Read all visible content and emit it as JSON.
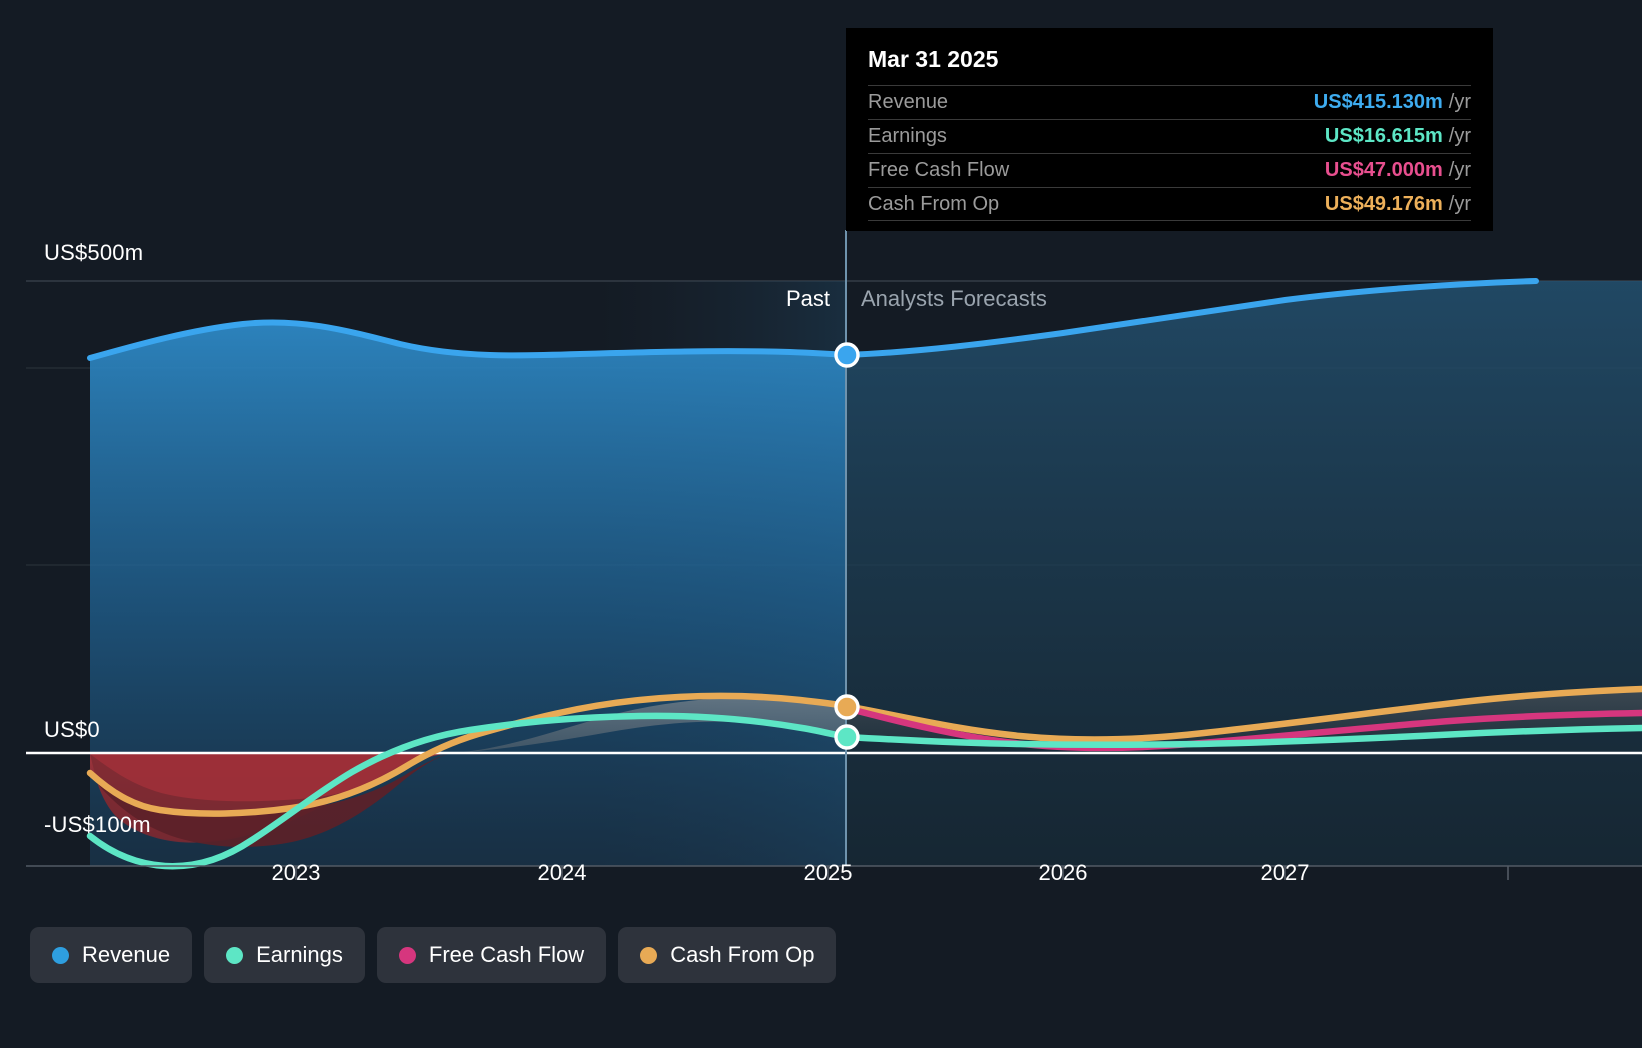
{
  "axes": {
    "y_labels": [
      {
        "text": "US$500m",
        "value": 500
      },
      {
        "text": "US$0",
        "value": 0
      },
      {
        "text": "-US$100m",
        "value": -100
      }
    ],
    "x_labels": [
      "2023",
      "2024",
      "2025",
      "2026",
      "2027"
    ]
  },
  "regions": {
    "past_label": "Past",
    "forecast_label": "Analysts Forecasts"
  },
  "tooltip": {
    "date": "Mar 31 2025",
    "rows": [
      {
        "label": "Revenue",
        "value": "US$415.130m",
        "unit": "/yr",
        "color": "#3eacf0"
      },
      {
        "label": "Earnings",
        "value": "US$16.615m",
        "unit": "/yr",
        "color": "#5de6c5"
      },
      {
        "label": "Free Cash Flow",
        "value": "US$47.000m",
        "unit": "/yr",
        "color": "#e84f8f"
      },
      {
        "label": "Cash From Op",
        "value": "US$49.176m",
        "unit": "/yr",
        "color": "#edb05a"
      }
    ]
  },
  "legend": [
    {
      "label": "Revenue",
      "color": "#2e9fe0"
    },
    {
      "label": "Earnings",
      "color": "#5de6c5"
    },
    {
      "label": "Free Cash Flow",
      "color": "#d6367e"
    },
    {
      "label": "Cash From Op",
      "color": "#e8aa55"
    }
  ],
  "colors": {
    "background": "#141b24",
    "revenue": "#2e9fe0",
    "earnings": "#5de6c5",
    "free_cash_flow": "#d6367e",
    "cash_from_op": "#e8aa55",
    "negative_area": "#8f2a33",
    "zero_line": "#ffffff",
    "divider": "#7ea6c4"
  },
  "chart_data": {
    "type": "area",
    "title": "",
    "xlabel": "",
    "ylabel": "US$",
    "ylim": [
      -130,
      520
    ],
    "xlim": [
      2022.35,
      2027.85
    ],
    "grid": true,
    "legend_position": "bottom-left",
    "past_forecast_boundary": 2025.23,
    "highlight_date": "Mar 31 2025",
    "highlight_values": {
      "Revenue": 415.13,
      "Earnings": 16.615,
      "Free Cash Flow": 47.0,
      "Cash From Op": 49.176
    },
    "x": [
      2022.35,
      2022.6,
      2022.85,
      2023.1,
      2023.35,
      2023.6,
      2023.85,
      2024.1,
      2024.35,
      2024.6,
      2024.85,
      2025.1,
      2025.23,
      2025.5,
      2025.85,
      2026.1,
      2026.5,
      2026.85,
      2027.25,
      2027.85
    ],
    "series": [
      {
        "name": "Revenue",
        "color": "#2e9fe0",
        "values": [
          423,
          438,
          448,
          446,
          434,
          427,
          425,
          426,
          426,
          424,
          420,
          417,
          415,
          417,
          424,
          433,
          449,
          464,
          483,
          502
        ]
      },
      {
        "name": "Earnings",
        "color": "#5de6c5",
        "values": [
          -88,
          -110,
          -122,
          -118,
          -100,
          -72,
          -40,
          -14,
          4,
          16,
          22,
          20,
          17,
          8,
          2,
          0,
          2,
          5,
          10,
          16
        ]
      },
      {
        "name": "Free Cash Flow",
        "color": "#d6367e",
        "values": [
          null,
          null,
          null,
          null,
          null,
          null,
          null,
          null,
          null,
          null,
          null,
          null,
          47,
          34,
          22,
          20,
          24,
          29,
          36,
          44
        ]
      },
      {
        "name": "Cash From Op",
        "color": "#e8aa55",
        "values": [
          -22,
          -52,
          -62,
          -62,
          -56,
          -38,
          -6,
          12,
          22,
          32,
          40,
          44,
          49,
          40,
          32,
          30,
          34,
          40,
          48,
          58
        ]
      }
    ]
  }
}
